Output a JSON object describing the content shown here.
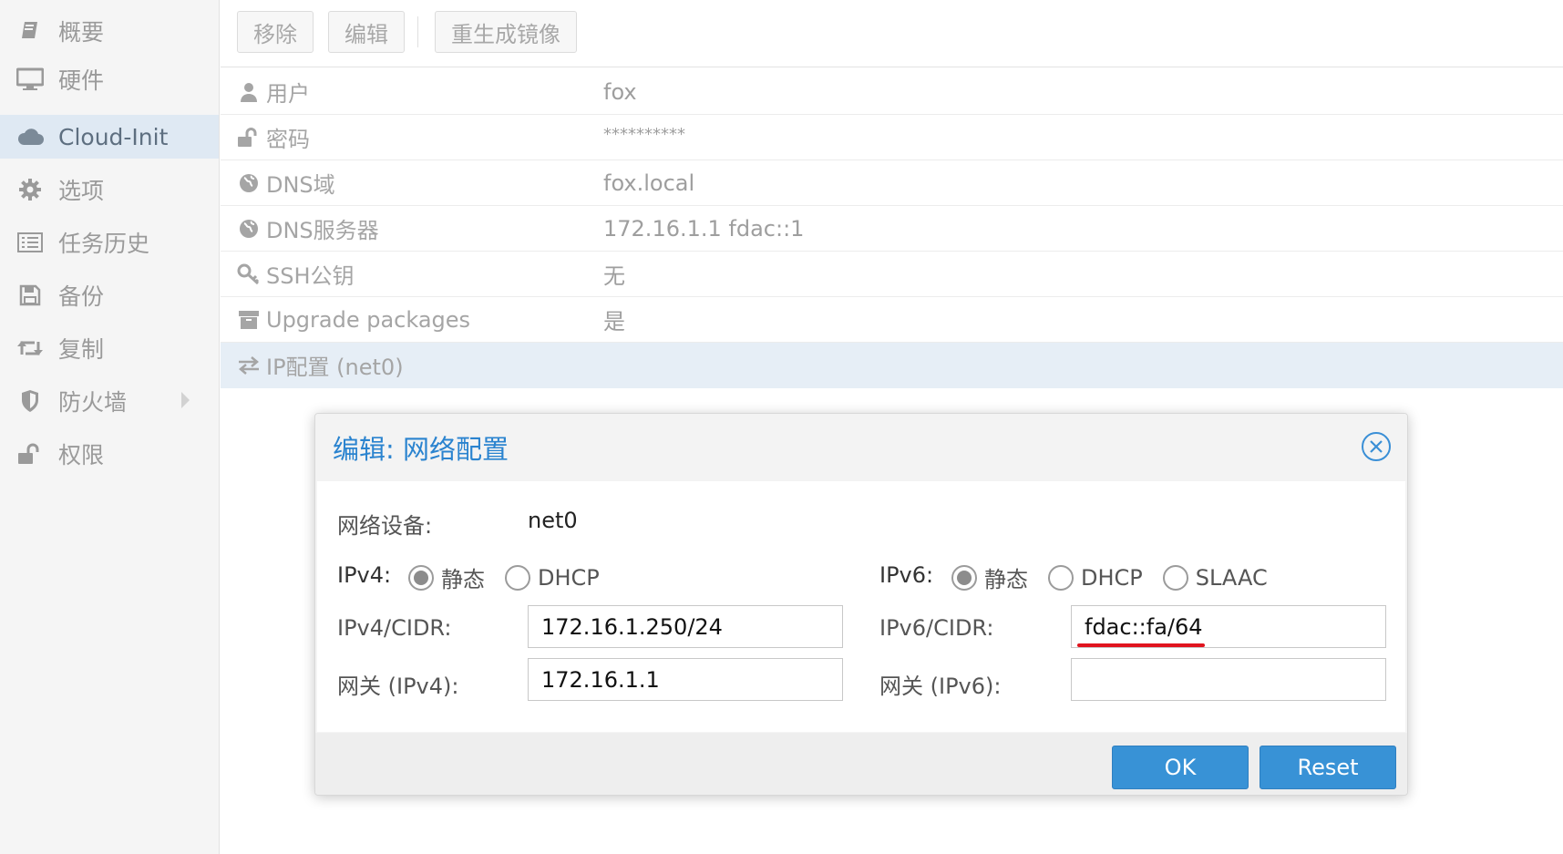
{
  "sidebar": {
    "items": [
      {
        "label": "概要",
        "icon": "book-icon"
      },
      {
        "label": "硬件",
        "icon": "monitor-icon"
      },
      {
        "label": "Cloud-Init",
        "icon": "cloud-icon",
        "active": true
      },
      {
        "label": "选项",
        "icon": "gear-icon"
      },
      {
        "label": "任务历史",
        "icon": "list-icon"
      },
      {
        "label": "备份",
        "icon": "floppy-icon"
      },
      {
        "label": "复制",
        "icon": "retweet-icon"
      },
      {
        "label": "防火墙",
        "icon": "shield-icon",
        "has_submenu": true
      },
      {
        "label": "权限",
        "icon": "unlock-icon"
      }
    ]
  },
  "toolbar": {
    "remove_label": "移除",
    "edit_label": "编辑",
    "regenerate_label": "重生成镜像"
  },
  "properties": [
    {
      "key": "用户",
      "value": "fox",
      "icon": "user-icon"
    },
    {
      "key": "密码",
      "value": "**********",
      "icon": "unlock-icon"
    },
    {
      "key": "DNS域",
      "value": "fox.local",
      "icon": "globe-icon"
    },
    {
      "key": "DNS服务器",
      "value": "172.16.1.1 fdac::1",
      "icon": "globe-icon"
    },
    {
      "key": "SSH公钥",
      "value": "无",
      "icon": "key-icon"
    },
    {
      "key": "Upgrade packages",
      "value": "是",
      "icon": "archive-icon"
    },
    {
      "key": "IP配置 (net0)",
      "value": "",
      "icon": "exchange-icon",
      "selected": true
    }
  ],
  "dialog": {
    "title": "编辑: 网络配置",
    "device_label": "网络设备:",
    "device_value": "net0",
    "ipv4": {
      "label": "IPv4:",
      "options": [
        "静态",
        "DHCP"
      ],
      "selected": "静态",
      "cidr_label": "IPv4/CIDR:",
      "cidr_value": "172.16.1.250/24",
      "gateway_label": "网关 (IPv4):",
      "gateway_value": "172.16.1.1"
    },
    "ipv6": {
      "label": "IPv6:",
      "options": [
        "静态",
        "DHCP",
        "SLAAC"
      ],
      "selected": "静态",
      "cidr_label": "IPv6/CIDR:",
      "cidr_value": "fdac::fa/64",
      "gateway_label": "网关 (IPv6):",
      "gateway_value": ""
    },
    "ok_label": "OK",
    "reset_label": "Reset"
  },
  "colors": {
    "accent": "#3892d6",
    "title": "#2a83cf",
    "highlight_underline": "#e0141e",
    "selected_row": "#e6eef6"
  }
}
